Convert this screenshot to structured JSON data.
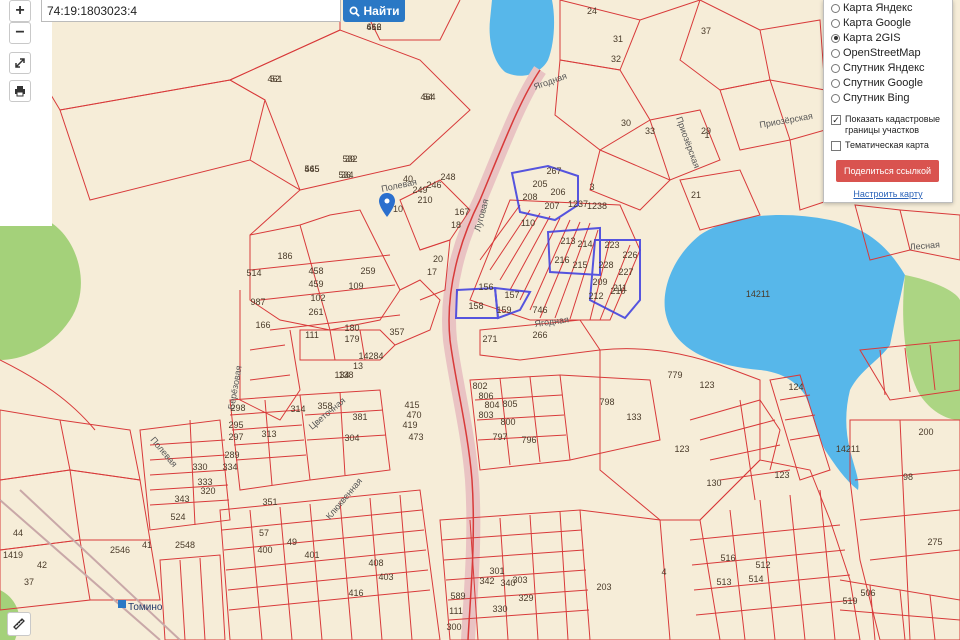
{
  "search": {
    "value": "74:19:1803023:4",
    "button_label": "Найти"
  },
  "zoom": {
    "in_label": "+",
    "out_label": "−"
  },
  "tools": {
    "expand_icon": "expand-icon",
    "print_icon": "printer-icon",
    "ruler_icon": "ruler-icon"
  },
  "layers": {
    "options": [
      {
        "label": "Карта Яндекс",
        "selected": false
      },
      {
        "label": "Карта Google",
        "selected": false
      },
      {
        "label": "Карта 2GIS",
        "selected": true
      },
      {
        "label": "OpenStreetMap",
        "selected": false
      },
      {
        "label": "Спутник Яндекс",
        "selected": false
      },
      {
        "label": "Спутник Google",
        "selected": false
      },
      {
        "label": "Спутник Bing",
        "selected": false
      }
    ],
    "show_cadastral_label": "Показать кадастровые границы участков",
    "show_cadastral_checked": true,
    "thematic_label": "Тематическая карта",
    "thematic_checked": false,
    "share_label": "Поделиться ссылкой",
    "configure_label": "Настроить карту"
  },
  "colors": {
    "parcel": "#d83a3a",
    "highlight": "#3a3ae0",
    "water": "#57b7ea",
    "forest": "#a4d17a",
    "base": "#f6edd8"
  },
  "map": {
    "streets": [
      "Полевая",
      "Луговая",
      "Ягодная",
      "Ягодная",
      "Приозёрская",
      "Приозёрская",
      "Лесная",
      "Берёзовая",
      "Цветочная",
      "Клюквенная",
      "Полевая"
    ],
    "places": [
      "Томино"
    ],
    "parcels": [
      "616",
      "52",
      "54",
      "545",
      "39",
      "36",
      "40",
      "31",
      "32",
      "30",
      "33",
      "37",
      "29",
      "24",
      "3",
      "1",
      "21",
      "23",
      "248",
      "10",
      "210",
      "249",
      "246",
      "167",
      "18",
      "110",
      "267",
      "205",
      "206",
      "208",
      "207",
      "1237",
      "1238",
      "213",
      "214",
      "216",
      "215",
      "223",
      "226",
      "228",
      "227",
      "209",
      "210",
      "212",
      "211",
      "746",
      "159",
      "158",
      "156",
      "157",
      "266",
      "271",
      "123",
      "20",
      "17",
      "186",
      "458",
      "459",
      "102",
      "261",
      "259",
      "109",
      "180",
      "179",
      "357",
      "111",
      "987",
      "166",
      "514",
      "14284",
      "138",
      "13",
      "134",
      "779",
      "14211",
      "14211",
      "123",
      "124",
      "802",
      "806",
      "804",
      "805",
      "803",
      "800",
      "797",
      "796",
      "798",
      "133",
      "130",
      "123",
      "275",
      "98",
      "200",
      "203",
      "4",
      "589",
      "111",
      "300",
      "301",
      "303",
      "340",
      "342",
      "330",
      "329",
      "330",
      "333",
      "334",
      "320",
      "289",
      "295",
      "298",
      "297",
      "313",
      "314",
      "358",
      "304",
      "381",
      "351",
      "343",
      "524",
      "2548",
      "2546",
      "41",
      "44",
      "1419",
      "42",
      "37",
      "57",
      "49",
      "400",
      "401",
      "408",
      "403",
      "416",
      "419",
      "415",
      "470",
      "473",
      "516",
      "512",
      "513",
      "514",
      "519",
      "506",
      "462",
      "461",
      "464",
      "465",
      "532",
      "534"
    ]
  }
}
